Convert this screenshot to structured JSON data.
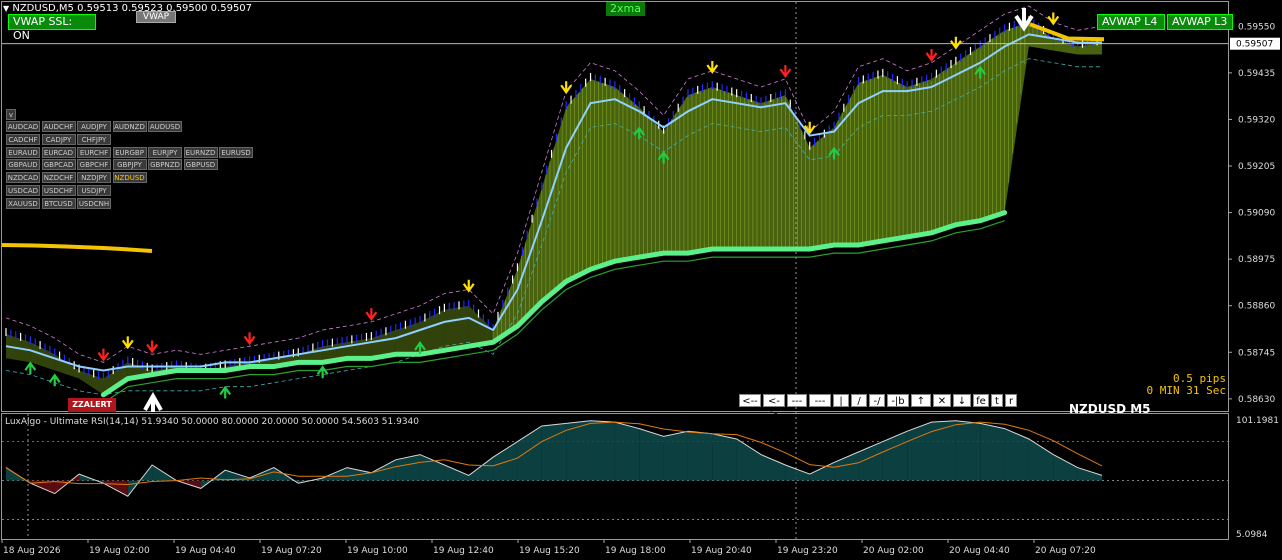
{
  "header": {
    "arrow_glyph": "▼",
    "symbol_info": "NZDUSD,M5  0.59513 0.59523 0.59500 0.59507",
    "vwap_ssl_label": "VWAP SSL: ON",
    "vwap_label": "VWAP",
    "ma_label": "2xma",
    "avwap_l4": "AVWAP L4",
    "avwap_l3": "AVWAP L3"
  },
  "symbol_panel": {
    "toggle_label": "v",
    "rows": [
      [
        "AUDCAD",
        "AUDCHF",
        "AUDJPY",
        "AUDNZD",
        "AUDUSD"
      ],
      [
        "CADCHF",
        "CADJPY",
        "CHFJPY"
      ],
      [
        "EURAUD",
        "EURCAD",
        "EURCHF",
        "EURGBP",
        "EURJPY",
        "EURNZD",
        "EURUSD"
      ],
      [
        "GBPAUD",
        "GBPCAD",
        "GBPCHF",
        "GBPJPY",
        "GBPNZD",
        "GBPUSD"
      ],
      [
        "NZDCAD",
        "NZDCHF",
        "NZDJPY",
        "NZDUSD"
      ],
      [
        "USDCAD",
        "USDCHF",
        "USDJPY"
      ],
      [
        "XAUUSD",
        "BTCUSD",
        "USDCNH"
      ]
    ],
    "active": "NZDUSD"
  },
  "zzalert_label": "ZZALERT",
  "toolbar": [
    "<--",
    "<->",
    "---",
    "---",
    "|",
    "/",
    "-/",
    "-|b",
    "↑",
    "✕",
    "↓",
    "fe",
    "t",
    "r"
  ],
  "info": {
    "pips": "0.5 pips",
    "timer": "0 MIN 31 Sec",
    "watermark": "NZDUSD M5"
  },
  "rsi": {
    "label": "LuxAlgo - Ultimate RSI(14,14) 51.9340 50.0000 80.0000 20.0000 50.0000 54.5603 51.9340",
    "ymax_label": "101.1981",
    "ymin_label": "5.0984"
  },
  "colors": {
    "bull_fill": "#5a7a12",
    "bull_stroke": "#9bc23c",
    "bear_fill": "#8b0000",
    "candle_up": "#1f2bff",
    "candle_down": "#ffffff",
    "vwap_line": "#8fd0ff",
    "ma_thick": "#5cf08a",
    "yellow_line": "#f5c400",
    "arrow_up": "#22cc44",
    "arrow_down": "#ff2020",
    "arrow_yellow": "#ffe000"
  },
  "chart_data": {
    "type": "line",
    "title": "NZDUSD,M5",
    "price_ticks": [
      "0.59550",
      "0.59435",
      "0.59320",
      "0.59205",
      "0.59090",
      "0.58975",
      "0.58860",
      "0.58745",
      "0.58630"
    ],
    "current_price": "0.59507",
    "ylim": [
      0.586,
      0.5961
    ],
    "x_tick_labels": [
      "18 Aug 2026",
      "19 Aug 02:00",
      "19 Aug 04:40",
      "19 Aug 07:20",
      "19 Aug 10:00",
      "19 Aug 12:40",
      "19 Aug 15:20",
      "19 Aug 18:00",
      "19 Aug 20:40",
      "19 Aug 23:20",
      "20 Aug 02:00",
      "20 Aug 04:40",
      "20 Aug 07:20"
    ],
    "series": [
      {
        "name": "price",
        "values": [
          0.5879,
          0.5877,
          0.5874,
          0.587,
          0.5868,
          0.5872,
          0.587,
          0.5871,
          0.587,
          0.5871,
          0.5872,
          0.5873,
          0.5874,
          0.5876,
          0.5877,
          0.5878,
          0.588,
          0.5882,
          0.5885,
          0.5886,
          0.588,
          0.5895,
          0.5915,
          0.5935,
          0.5942,
          0.594,
          0.5935,
          0.5929,
          0.5938,
          0.594,
          0.5938,
          0.5936,
          0.5938,
          0.5925,
          0.593,
          0.5941,
          0.5943,
          0.594,
          0.5942,
          0.5946,
          0.595,
          0.5954,
          0.5956,
          0.5952,
          0.595,
          0.5951
        ]
      },
      {
        "name": "vwap",
        "values": [
          0.5876,
          0.5875,
          0.5873,
          0.5871,
          0.587,
          0.5871,
          0.5871,
          0.5871,
          0.5871,
          0.5872,
          0.5872,
          0.5873,
          0.5874,
          0.5875,
          0.5876,
          0.5877,
          0.5878,
          0.588,
          0.5882,
          0.5883,
          0.588,
          0.589,
          0.5907,
          0.5925,
          0.5936,
          0.5937,
          0.5934,
          0.593,
          0.5934,
          0.5937,
          0.5936,
          0.5935,
          0.5936,
          0.5928,
          0.5929,
          0.5936,
          0.5939,
          0.5939,
          0.594,
          0.5943,
          0.5946,
          0.595,
          0.5953,
          0.5952,
          0.5951,
          0.5951
        ]
      },
      {
        "name": "ma",
        "values": [
          null,
          null,
          null,
          null,
          0.5864,
          0.5868,
          0.5869,
          0.587,
          0.587,
          0.587,
          0.5871,
          0.5871,
          0.5872,
          0.5872,
          0.5873,
          0.5873,
          0.5874,
          0.5874,
          0.5875,
          0.5876,
          0.5877,
          0.5881,
          0.5887,
          0.5892,
          0.5895,
          0.5897,
          0.5898,
          0.5899,
          0.5899,
          0.59,
          0.59,
          0.59,
          0.59,
          0.59,
          0.5901,
          0.5901,
          0.5902,
          0.5903,
          0.5904,
          0.5906,
          0.5907,
          0.5909
        ]
      },
      {
        "name": "rsi",
        "values": [
          60,
          48,
          40,
          55,
          48,
          38,
          62,
          50,
          44,
          58,
          52,
          60,
          48,
          52,
          60,
          56,
          66,
          70,
          62,
          54,
          68,
          80,
          92,
          94,
          96,
          95,
          90,
          84,
          88,
          86,
          82,
          70,
          62,
          55,
          64,
          72,
          80,
          88,
          95,
          96,
          94,
          90,
          82,
          70,
          60,
          54
        ]
      }
    ]
  }
}
